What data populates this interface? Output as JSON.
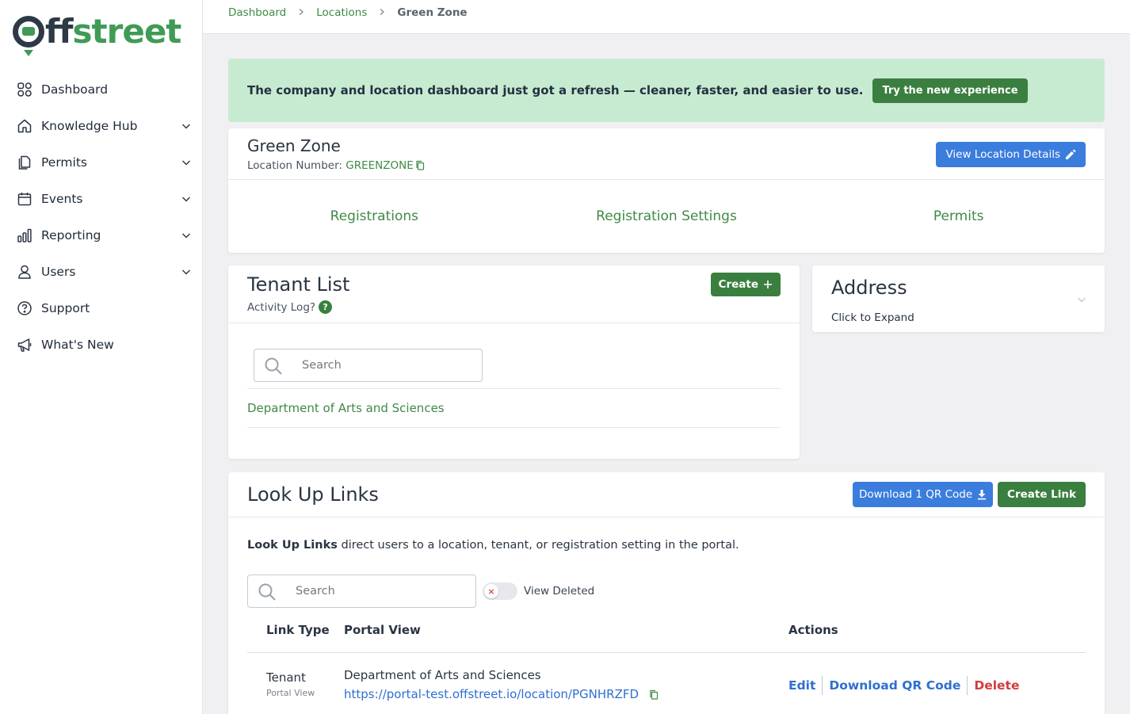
{
  "brand": {
    "logo_text_dark": "O",
    "logo_text_ff": "ff",
    "logo_text_green": "street",
    "primary_color": "#3a7f3f",
    "accent_blue": "#3b7ddd"
  },
  "sidebar": {
    "items": [
      {
        "label": "Dashboard",
        "icon": "grid-icon",
        "expandable": false
      },
      {
        "label": "Knowledge Hub",
        "icon": "home-icon",
        "expandable": true
      },
      {
        "label": "Permits",
        "icon": "document-icon",
        "expandable": true
      },
      {
        "label": "Events",
        "icon": "calendar-icon",
        "expandable": true
      },
      {
        "label": "Reporting",
        "icon": "bar-chart-icon",
        "expandable": true
      },
      {
        "label": "Users",
        "icon": "user-icon",
        "expandable": true
      },
      {
        "label": "Support",
        "icon": "help-circle-icon",
        "expandable": false
      },
      {
        "label": "What's New",
        "icon": "megaphone-icon",
        "expandable": false
      }
    ]
  },
  "breadcrumb": {
    "items": [
      "Dashboard",
      "Locations"
    ],
    "current": "Green Zone"
  },
  "banner": {
    "text": "The company and location dashboard just got a refresh — cleaner, faster, and easier to use.",
    "button_label": "Try the new experience"
  },
  "location": {
    "name": "Green Zone",
    "number_label": "Location Number:",
    "number": "GREENZONE",
    "view_details_label": "View Location Details",
    "tabs": [
      "Registrations",
      "Registration Settings",
      "Permits"
    ]
  },
  "tenant_list": {
    "title": "Tenant List",
    "activity_log": "Activity Log?",
    "help_badge": "?",
    "create_label": "Create",
    "search_placeholder": "Search",
    "rows": [
      "Department of Arts and Sciences"
    ]
  },
  "address": {
    "title": "Address",
    "subtitle": "Click to Expand"
  },
  "lookup_links": {
    "title": "Look Up Links",
    "download_label": "Download 1 QR Code",
    "create_label": "Create Link",
    "desc_bold": "Look Up Links",
    "desc_rest": " direct users to a location, tenant, or registration setting in the portal.",
    "search_placeholder": "Search",
    "view_deleted_label": "View Deleted",
    "view_deleted_on": false,
    "columns": [
      "Link Type",
      "Portal View",
      "Actions"
    ],
    "rows": [
      {
        "type": "Tenant",
        "type_sub": "Portal View",
        "portal_name": "Department of Arts and Sciences",
        "url": "https://portal-test.offstreet.io/location/PGNHRZFD",
        "actions": [
          "Edit",
          "Download QR Code",
          "Delete"
        ]
      }
    ]
  }
}
